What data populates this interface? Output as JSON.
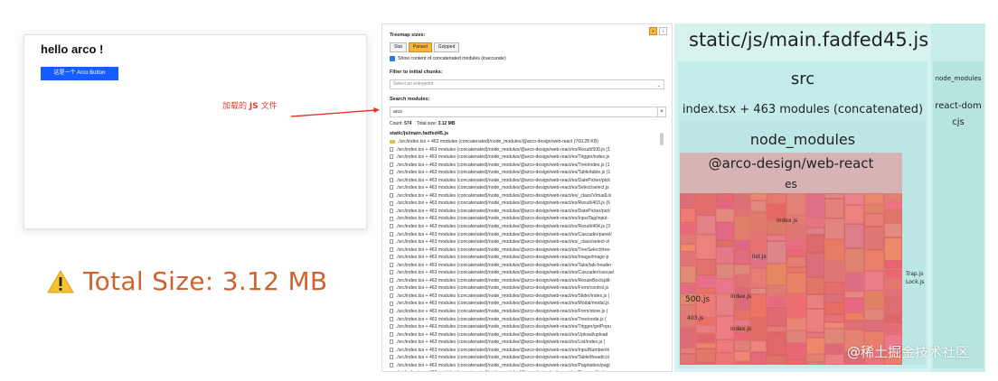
{
  "demo": {
    "title": "hello arco !",
    "button_label": "这是一个 Arco Button"
  },
  "annotation": {
    "text_prefix": "加载的 ",
    "text_bold": "JS",
    "text_suffix": " 文件"
  },
  "total": {
    "text": "Total Size: 3.12 MB",
    "icon": "warning-icon"
  },
  "analyzer": {
    "treemap_sizes_label": "Treemap sizes:",
    "size_buttons": [
      "Stat",
      "Parsed",
      "Gzipped"
    ],
    "active_size": "Parsed",
    "concat_checkbox_label": "Show content of concatenated modules (inaccurate)",
    "filter_label": "Filter to initial chunks:",
    "entry_placeholder": "Select an entrypoint",
    "search_label": "Search modules:",
    "search_value": "arco",
    "count_label": "Count:",
    "count_value": "574",
    "total_size_label": "Total size:",
    "total_size_value": "3.12 MB",
    "chunk_name": "static/js/main.fadfed45.js",
    "rows": [
      "./src/index.tsx + 463 modules (concatenated)/node_modules/@arco-design/web-react (760.28 KB)",
      "./src/index.tsx + 463 modules (concatenated)/node_modules/@arco-design/web-react/es/Result/500.js (1",
      "./src/index.tsx + 463 modules (concatenated)/node_modules/@arco-design/web-react/es/Trigger/index.js",
      "./src/index.tsx + 463 modules (concatenated)/node_modules/@arco-design/web-react/es/Tree/index.js (1",
      "./src/index.tsx + 463 modules (concatenated)/node_modules/@arco-design/web-react/es/Table/table.js (1",
      "./src/index.tsx + 463 modules (concatenated)/node_modules/@arco-design/web-react/es/DatePicker/pick",
      "./src/index.tsx + 463 modules (concatenated)/node_modules/@arco-design/web-react/es/Select/select.js",
      "./src/index.tsx + 463 modules (concatenated)/node_modules/@arco-design/web-react/es/_class/VirtualLis",
      "./src/index.tsx + 463 modules (concatenated)/node_modules/@arco-design/web-react/es/Result/403.js (6",
      "./src/index.tsx + 463 modules (concatenated)/node_modules/@arco-design/web-react/es/DatePicker/pick",
      "./src/index.tsx + 463 modules (concatenated)/node_modules/@arco-design/web-react/es/InputTag/input-",
      "./src/index.tsx + 463 modules (concatenated)/node_modules/@arco-design/web-react/es/Result/404.js (3",
      "./src/index.tsx + 463 modules (concatenated)/node_modules/@arco-design/web-react/es/Cascader/panel/",
      "./src/index.tsx + 463 modules (concatenated)/node_modules/@arco-design/web-react/es/_class/select-vi",
      "./src/index.tsx + 463 modules (concatenated)/node_modules/@arco-design/web-react/es/TreeSelect/tree-",
      "./src/index.tsx + 463 modules (concatenated)/node_modules/@arco-design/web-react/es/Image/image-p",
      "./src/index.tsx + 463 modules (concatenated)/node_modules/@arco-design/web-react/es/Tabs/tab-header",
      "./src/index.tsx + 463 modules (concatenated)/node_modules/@arco-design/web-react/es/Cascader/cascad",
      "./src/index.tsx + 463 modules (concatenated)/node_modules/@arco-design/web-react/es/ResizeBox/split-",
      "./src/index.tsx + 463 modules (concatenated)/node_modules/@arco-design/web-react/es/Form/control.js",
      "./src/index.tsx + 463 modules (concatenated)/node_modules/@arco-design/web-react/es/Slider/index.js (",
      "./src/index.tsx + 463 modules (concatenated)/node_modules/@arco-design/web-react/es/Modal/modal.js",
      "./src/index.tsx + 463 modules (concatenated)/node_modules/@arco-design/web-react/es/Form/store.js (",
      "./src/index.tsx + 463 modules (concatenated)/node_modules/@arco-design/web-react/es/Tree/node.js (",
      "./src/index.tsx + 463 modules (concatenated)/node_modules/@arco-design/web-react/es/Trigger/getPopu",
      "./src/index.tsx + 463 modules (concatenated)/node_modules/@arco-design/web-react/es/Upload/upload",
      "./src/index.tsx + 463 modules (concatenated)/node_modules/@arco-design/web-react/es/List/index.js (",
      "./src/index.tsx + 463 modules (concatenated)/node_modules/@arco-design/web-react/es/InputNumber/in",
      "./src/index.tsx + 463 modules (concatenated)/node_modules/@arco-design/web-react/es/Table/thead/col",
      "./src/index.tsx + 463 modules (concatenated)/node_modules/@arco-design/web-react/es/Pagination/pagi",
      "./src/index.tsx + 463 modules (concatenated)/node_modules/@arco-design/web-react/es/Carousel/index"
    ]
  },
  "treemap": {
    "title": "static/js/main.fadfed45.js",
    "src": "src",
    "index_concat": "index.tsx + 463 modules (concatenated)",
    "node_modules": "node_modules",
    "arco": "@arco-design/web-react",
    "es": "es",
    "right_node_modules": "node_modules",
    "react_dom": "react-dom",
    "cjs": "cjs",
    "small_labels": [
      "500.js",
      "403.js",
      "index.js",
      "index.js",
      "list.js",
      "index.js",
      "Trap.js",
      "Lock.js"
    ],
    "watermark": "@稀土掘金技术社区"
  }
}
